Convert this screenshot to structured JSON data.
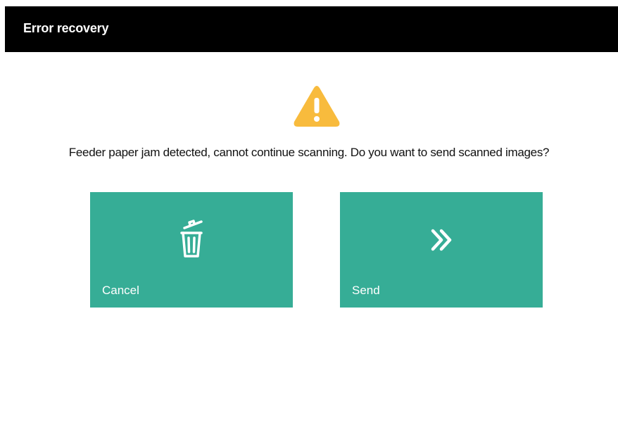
{
  "window": {
    "title": "Error recovery"
  },
  "dialog": {
    "icon": "warning-triangle-icon",
    "message": "Feeder paper jam detected, cannot continue scanning. Do you want to send scanned images?"
  },
  "buttons": {
    "cancel": {
      "label": "Cancel",
      "icon": "trash-can-icon"
    },
    "send": {
      "label": "Send",
      "icon": "double-chevron-right-icon"
    }
  },
  "colors": {
    "title_bar": "#000000",
    "button_bg": "#36ad96",
    "warning": "#f8bb3d"
  }
}
